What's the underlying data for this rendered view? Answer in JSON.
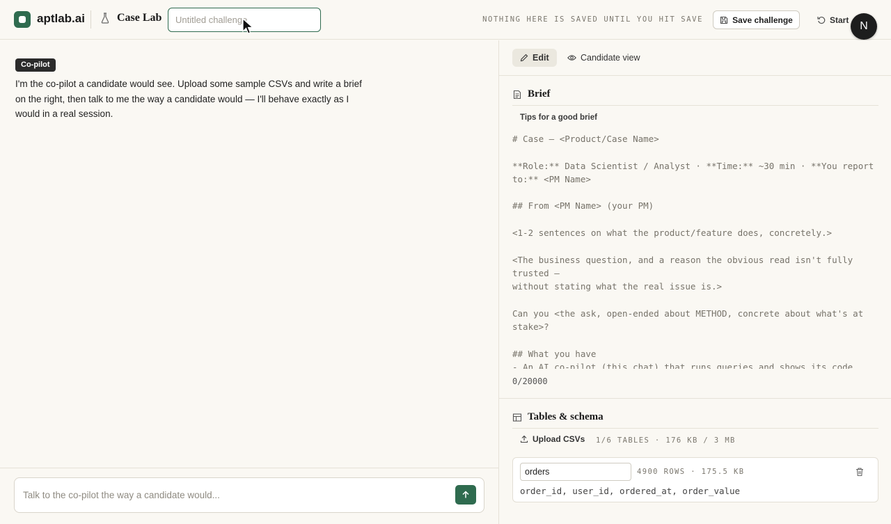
{
  "header": {
    "brand": "aptlab.ai",
    "section": "Case Lab",
    "title_input": {
      "value": "",
      "placeholder": "Untitled challenge"
    },
    "save_note": "NOTHING HERE IS SAVED UNTIL YOU HIT SAVE",
    "save_label": "Save challenge",
    "start_label": "Start",
    "avatar_initial": "N",
    "accent_color": "#2f6b4f"
  },
  "chat": {
    "badge": "Co-pilot",
    "message": "I'm the co-pilot a candidate would see. Upload some sample CSVs and write a brief on the right, then talk to me the way a candidate would — I'll behave exactly as I would in a real session.",
    "composer_placeholder": "Talk to the co-pilot the way a candidate would..."
  },
  "tabs": [
    {
      "label": "Edit",
      "icon": "pencil-icon",
      "active": true
    },
    {
      "label": "Candidate view",
      "icon": "eye-icon",
      "active": false
    }
  ],
  "brief": {
    "title": "Brief",
    "tips_label": "Tips for a good brief",
    "placeholder": "# Case — <Product/Case Name>\n\n**Role:** Data Scientist / Analyst · **Time:** ~30 min · **You report to:** <PM Name>\n\n## From <PM Name> (your PM)\n\n<1-2 sentences on what the product/feature does, concretely.>\n\n<The business question, and a reason the obvious read isn't fully trusted —\nwithout stating what the real issue is.>\n\nCan you <the ask, open-ended about METHOD, concrete about what's at stake>?\n\n## What you have\n- An AI co-pilot (this chat) that runs queries and shows its code",
    "char_count": "0/20000"
  },
  "tables": {
    "title": "Tables & schema",
    "upload_label": "Upload CSVs",
    "meta": "1/6 TABLES · 176 KB / 3 MB",
    "items": [
      {
        "name": "orders",
        "meta": "4900 ROWS · 175.5 KB",
        "columns": "order_id, user_id, ordered_at, order_value"
      }
    ]
  }
}
